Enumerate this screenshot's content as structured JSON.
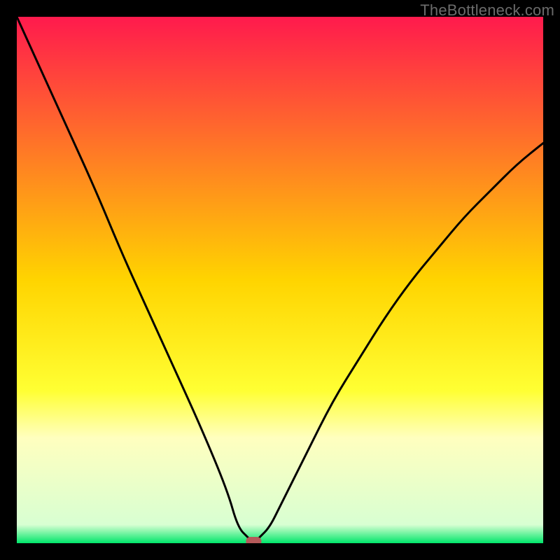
{
  "watermark": "TheBottleneck.com",
  "chart_data": {
    "type": "line",
    "title": "",
    "xlabel": "",
    "ylabel": "",
    "xlim": [
      0,
      100
    ],
    "ylim": [
      0,
      100
    ],
    "series": [
      {
        "name": "curve",
        "x": [
          0,
          5,
          10,
          15,
          20,
          25,
          30,
          35,
          40,
          42,
          44,
          45,
          46,
          48,
          50,
          55,
          60,
          65,
          70,
          75,
          80,
          85,
          90,
          95,
          100
        ],
        "y": [
          100,
          89,
          78,
          67,
          55,
          44,
          33,
          22,
          10,
          3,
          1,
          0,
          1,
          3,
          7,
          17,
          27,
          35,
          43,
          50,
          56,
          62,
          67,
          72,
          76
        ]
      }
    ],
    "marker": {
      "x": 45,
      "y": 0,
      "color": "#b55a5a"
    },
    "gradient_stops": [
      {
        "offset": 0.0,
        "color": "#ff1a4d"
      },
      {
        "offset": 0.5,
        "color": "#ffd400"
      },
      {
        "offset": 0.71,
        "color": "#ffff33"
      },
      {
        "offset": 0.8,
        "color": "#ffffbf"
      },
      {
        "offset": 0.965,
        "color": "#d8ffd2"
      },
      {
        "offset": 1.0,
        "color": "#00e66a"
      }
    ],
    "colors": {
      "curve": "#000000",
      "background_border": "#000000"
    }
  }
}
